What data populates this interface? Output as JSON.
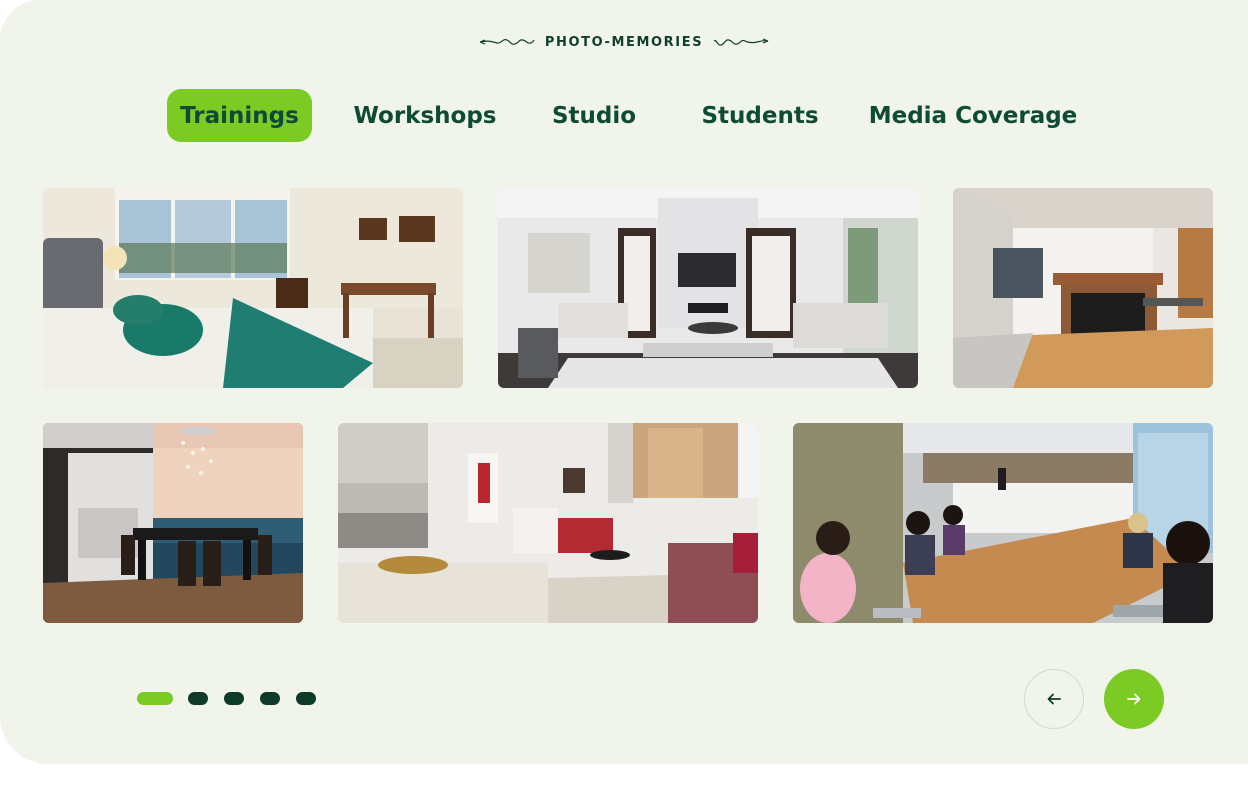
{
  "section": {
    "eyebrow": "PHOTO-MEMORIES"
  },
  "tabs": [
    {
      "label": "Trainings",
      "active": true
    },
    {
      "label": "Workshops",
      "active": false
    },
    {
      "label": "Studio",
      "active": false
    },
    {
      "label": "Students",
      "active": false
    },
    {
      "label": "Media Coverage",
      "active": false
    }
  ],
  "gallery": {
    "photos": [
      {
        "subject": "bedroom-photo"
      },
      {
        "subject": "living-room-photo"
      },
      {
        "subject": "fireplace-room-photo"
      },
      {
        "subject": "dining-room-ocean-view-photo"
      },
      {
        "subject": "kitchen-living-area-photo"
      },
      {
        "subject": "conference-room-meeting-photo"
      }
    ]
  },
  "pagination": {
    "total": 5,
    "active_index": 0
  },
  "nav": {
    "prev_icon": "arrow-left-icon",
    "next_icon": "arrow-right-icon"
  },
  "colors": {
    "background": "#f0f4ea",
    "accent": "#7ccb24",
    "dark_green": "#0f4a35"
  }
}
